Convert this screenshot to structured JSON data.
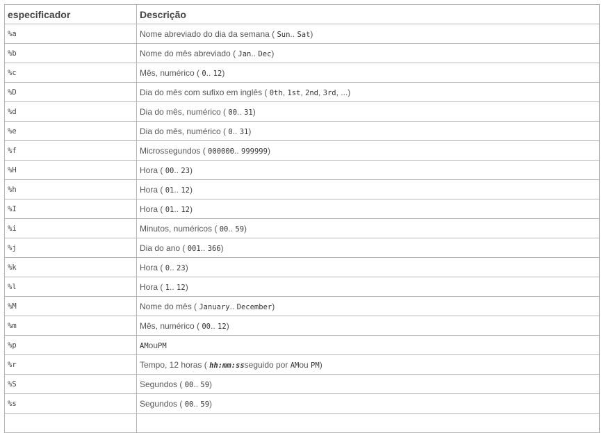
{
  "table": {
    "headers": [
      "especificador",
      "Descrição"
    ],
    "rows": [
      {
        "spec": "%a",
        "desc": [
          {
            "t": "Nome abreviado do dia da semana ( "
          },
          {
            "c": "Sun"
          },
          {
            "t": ".. "
          },
          {
            "c": "Sat"
          },
          {
            "t": ")"
          }
        ]
      },
      {
        "spec": "%b",
        "desc": [
          {
            "t": "Nome do mês abreviado ( "
          },
          {
            "c": "Jan"
          },
          {
            "t": ".. "
          },
          {
            "c": "Dec"
          },
          {
            "t": ")"
          }
        ]
      },
      {
        "spec": "%c",
        "desc": [
          {
            "t": "Mês, numérico ( "
          },
          {
            "c": "0"
          },
          {
            "t": ".. "
          },
          {
            "c": "12"
          },
          {
            "t": ")"
          }
        ]
      },
      {
        "spec": "%D",
        "desc": [
          {
            "t": "Dia do mês com sufixo em inglês ( "
          },
          {
            "c": "0th"
          },
          {
            "t": ", "
          },
          {
            "c": "1st"
          },
          {
            "t": ", "
          },
          {
            "c": "2nd"
          },
          {
            "t": ", "
          },
          {
            "c": "3rd"
          },
          {
            "t": ", ...)"
          }
        ]
      },
      {
        "spec": "%d",
        "desc": [
          {
            "t": "Dia do mês, numérico ( "
          },
          {
            "c": "00"
          },
          {
            "t": ".. "
          },
          {
            "c": "31"
          },
          {
            "t": ")"
          }
        ]
      },
      {
        "spec": "%e",
        "desc": [
          {
            "t": "Dia do mês, numérico ( "
          },
          {
            "c": "0"
          },
          {
            "t": ".. "
          },
          {
            "c": "31"
          },
          {
            "t": ")"
          }
        ]
      },
      {
        "spec": "%f",
        "desc": [
          {
            "t": "Microssegundos ( "
          },
          {
            "c": "000000"
          },
          {
            "t": ".. "
          },
          {
            "c": "999999"
          },
          {
            "t": ")"
          }
        ]
      },
      {
        "spec": "%H",
        "desc": [
          {
            "t": "Hora ( "
          },
          {
            "c": "00"
          },
          {
            "t": ".. "
          },
          {
            "c": "23"
          },
          {
            "t": ")"
          }
        ]
      },
      {
        "spec": "%h",
        "desc": [
          {
            "t": "Hora ( "
          },
          {
            "c": "01"
          },
          {
            "t": ".. "
          },
          {
            "c": "12"
          },
          {
            "t": ")"
          }
        ]
      },
      {
        "spec": "%I",
        "desc": [
          {
            "t": "Hora ( "
          },
          {
            "c": "01"
          },
          {
            "t": ".. "
          },
          {
            "c": "12"
          },
          {
            "t": ")"
          }
        ]
      },
      {
        "spec": "%i",
        "desc": [
          {
            "t": "Minutos, numéricos ( "
          },
          {
            "c": "00"
          },
          {
            "t": ".. "
          },
          {
            "c": "59"
          },
          {
            "t": ")"
          }
        ]
      },
      {
        "spec": "%j",
        "desc": [
          {
            "t": "Dia do ano ( "
          },
          {
            "c": "001"
          },
          {
            "t": ".. "
          },
          {
            "c": "366"
          },
          {
            "t": ")"
          }
        ]
      },
      {
        "spec": "%k",
        "desc": [
          {
            "t": "Hora ( "
          },
          {
            "c": "0"
          },
          {
            "t": ".. "
          },
          {
            "c": "23"
          },
          {
            "t": ")"
          }
        ]
      },
      {
        "spec": "%l",
        "desc": [
          {
            "t": "Hora ( "
          },
          {
            "c": "1"
          },
          {
            "t": ".. "
          },
          {
            "c": "12"
          },
          {
            "t": ")"
          }
        ]
      },
      {
        "spec": "%M",
        "desc": [
          {
            "t": "Nome do mês ( "
          },
          {
            "c": "January"
          },
          {
            "t": ".. "
          },
          {
            "c": "December"
          },
          {
            "t": ")"
          }
        ]
      },
      {
        "spec": "%m",
        "desc": [
          {
            "t": "Mês, numérico ( "
          },
          {
            "c": "00"
          },
          {
            "t": ".. "
          },
          {
            "c": "12"
          },
          {
            "t": ")"
          }
        ]
      },
      {
        "spec": "%p",
        "desc": [
          {
            "c": "AM"
          },
          {
            "t": "ou"
          },
          {
            "c": "PM"
          }
        ]
      },
      {
        "spec": "%r",
        "desc": [
          {
            "t": "Tempo, 12 horas ( "
          },
          {
            "ci": "hh:mm:ss"
          },
          {
            "t": "seguido por "
          },
          {
            "c": "AM"
          },
          {
            "t": "ou "
          },
          {
            "c": "PM"
          },
          {
            "t": ")"
          }
        ]
      },
      {
        "spec": "%S",
        "desc": [
          {
            "t": "Segundos ( "
          },
          {
            "c": "00"
          },
          {
            "t": ".. "
          },
          {
            "c": "59"
          },
          {
            "t": ")"
          }
        ]
      },
      {
        "spec": "%s",
        "desc": [
          {
            "t": "Segundos ( "
          },
          {
            "c": "00"
          },
          {
            "t": ".. "
          },
          {
            "c": "59"
          },
          {
            "t": ")"
          }
        ]
      },
      {
        "spec": "",
        "desc": []
      }
    ]
  }
}
